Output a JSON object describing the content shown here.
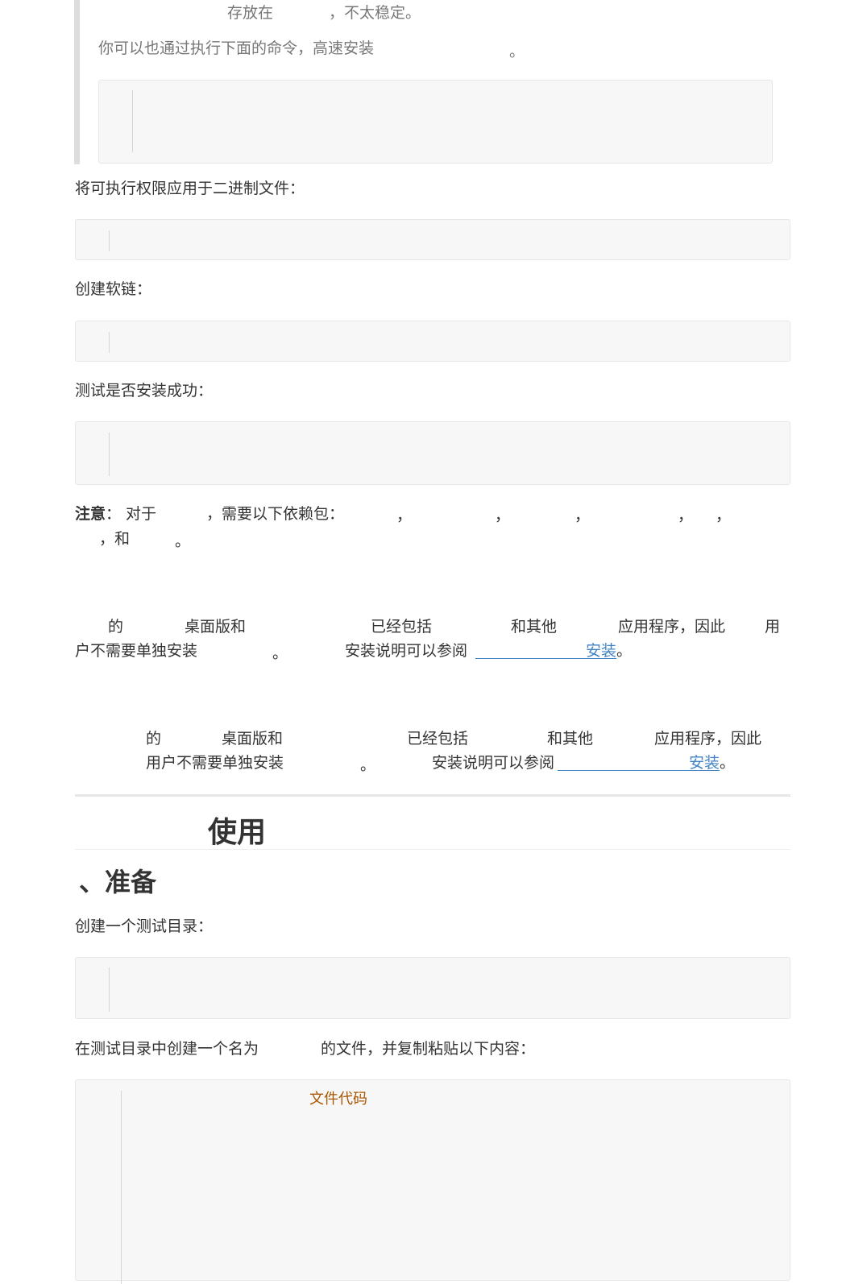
{
  "quote": {
    "line1_a": "存放在",
    "line1_b": "，不太稳定。",
    "line2_a": "你可以也通过执行下面的命令，高速安装",
    "line2_b": "。"
  },
  "paragraphs": {
    "chmod_intro": "将可执行权限应用于二进制文件：",
    "symlink_intro": "创建软链：",
    "verify_intro": "测试是否安装成功："
  },
  "note": {
    "label": "注意",
    "colon": "：",
    "text_a": "对于",
    "text_b": "，需要以下依赖包：",
    "comma": "，",
    "and": "，和",
    "period": "。"
  },
  "desktop_para_1": {
    "p1": "的",
    "p2": "桌面版和",
    "p3": "已经包括",
    "p4": "和其他",
    "p5": "应用程序，因此",
    "p6": "用",
    "p7": "户不需要单独安装",
    "p8": "。",
    "p9": "安装说明可以参阅",
    "link": "安装",
    "end": "。"
  },
  "desktop_para_2": {
    "p1": "的",
    "p2": "桌面版和",
    "p3": "已经包括",
    "p4": "和其他",
    "p5": "应用程序，因此",
    "p6": "用户不需要单独安装",
    "p7": "。",
    "p8": "安装说明可以参阅",
    "link": "安装",
    "end": "。"
  },
  "usage": {
    "heading": "使用",
    "sub_heading": "、准备",
    "mkdir_intro": "创建一个测试目录：",
    "file_intro_a": "在测试目录中创建一个名为",
    "file_intro_b": "的文件，并复制粘贴以下内容：",
    "code_comment": "文件代码"
  }
}
